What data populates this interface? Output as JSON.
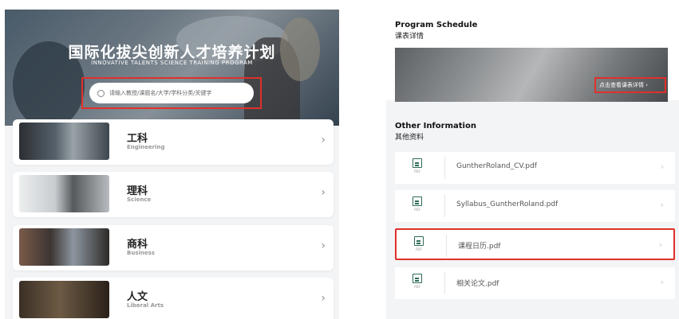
{
  "hero": {
    "title": "国际化拔尖创新人才培养计划",
    "subtitle": "INNOVATIVE TALENTS SCIENCE TRAINING PROGRAM",
    "search_placeholder": "请输入教授/课题名/大学/学科分类/关键字"
  },
  "categories": [
    {
      "name": "工科",
      "en": "Engineering",
      "icon": "chevron-right-icon"
    },
    {
      "name": "理科",
      "en": "Science",
      "icon": "chevron-right-icon"
    },
    {
      "name": "商科",
      "en": "Business",
      "icon": "chevron-right-icon"
    },
    {
      "name": "人文",
      "en": "Liberal Arts",
      "icon": "chevron-right-icon"
    }
  ],
  "schedule": {
    "title": "Program Schedule",
    "subtitle": "课表详情",
    "cta": "点击查看课表详情 ›"
  },
  "other_info": {
    "title": "Other Information",
    "subtitle": "其他资料",
    "file_type_label": "PDF",
    "files": [
      {
        "name": "GuntherRoland_CV.pdf"
      },
      {
        "name": "Syllabus_GuntherRoland.pdf"
      },
      {
        "name": "课程日历.pdf"
      },
      {
        "name": "相关论文.pdf"
      }
    ]
  },
  "colors": {
    "highlight": "#e0302a",
    "pdf_icon": "#2f6b55",
    "panel_bg": "#f3f4f6"
  }
}
